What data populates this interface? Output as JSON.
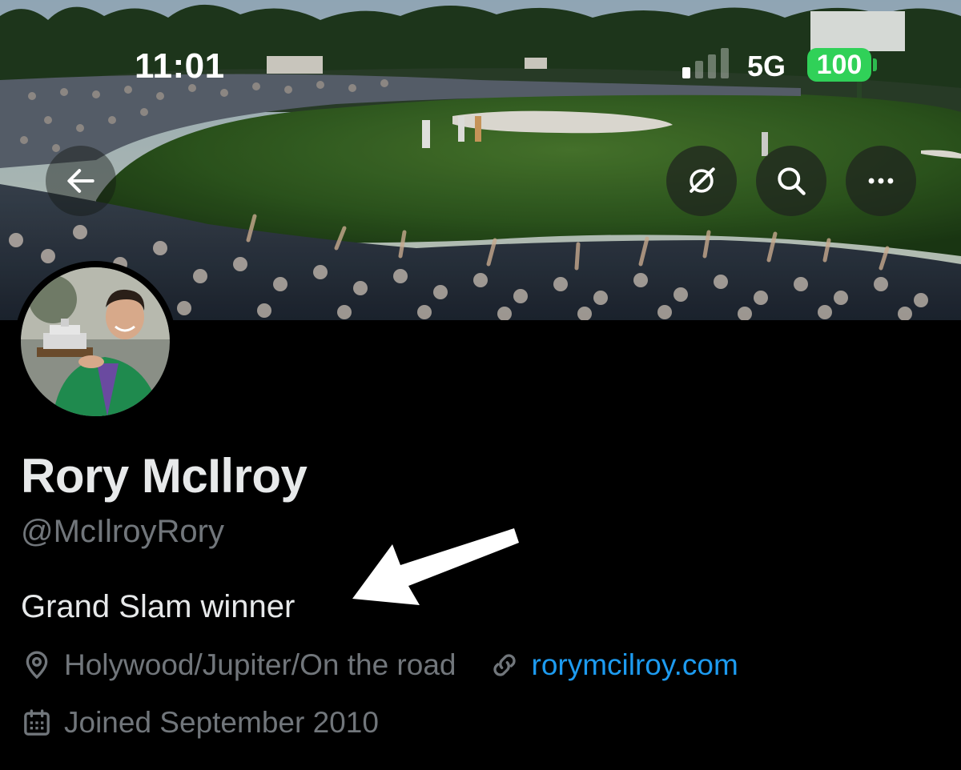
{
  "status_bar": {
    "time": "11:01",
    "network": "5G",
    "battery": "100",
    "battery_color": "#30d158"
  },
  "nav": {
    "back_icon": "arrow-left-icon",
    "grok_icon": "grok-icon",
    "search_icon": "search-icon",
    "more_icon": "more-horizontal-icon"
  },
  "profile": {
    "display_name": "Rory McIlroy",
    "handle": "@McIlroyRory",
    "bio": "Grand Slam winner",
    "location": "Holywood/Jupiter/On the road",
    "website": "rorymcilroy.com",
    "joined": "Joined September 2010"
  },
  "colors": {
    "background": "#000000",
    "primary_text": "#e7e9ea",
    "secondary_text": "#71767b",
    "link": "#1d9bf0"
  }
}
